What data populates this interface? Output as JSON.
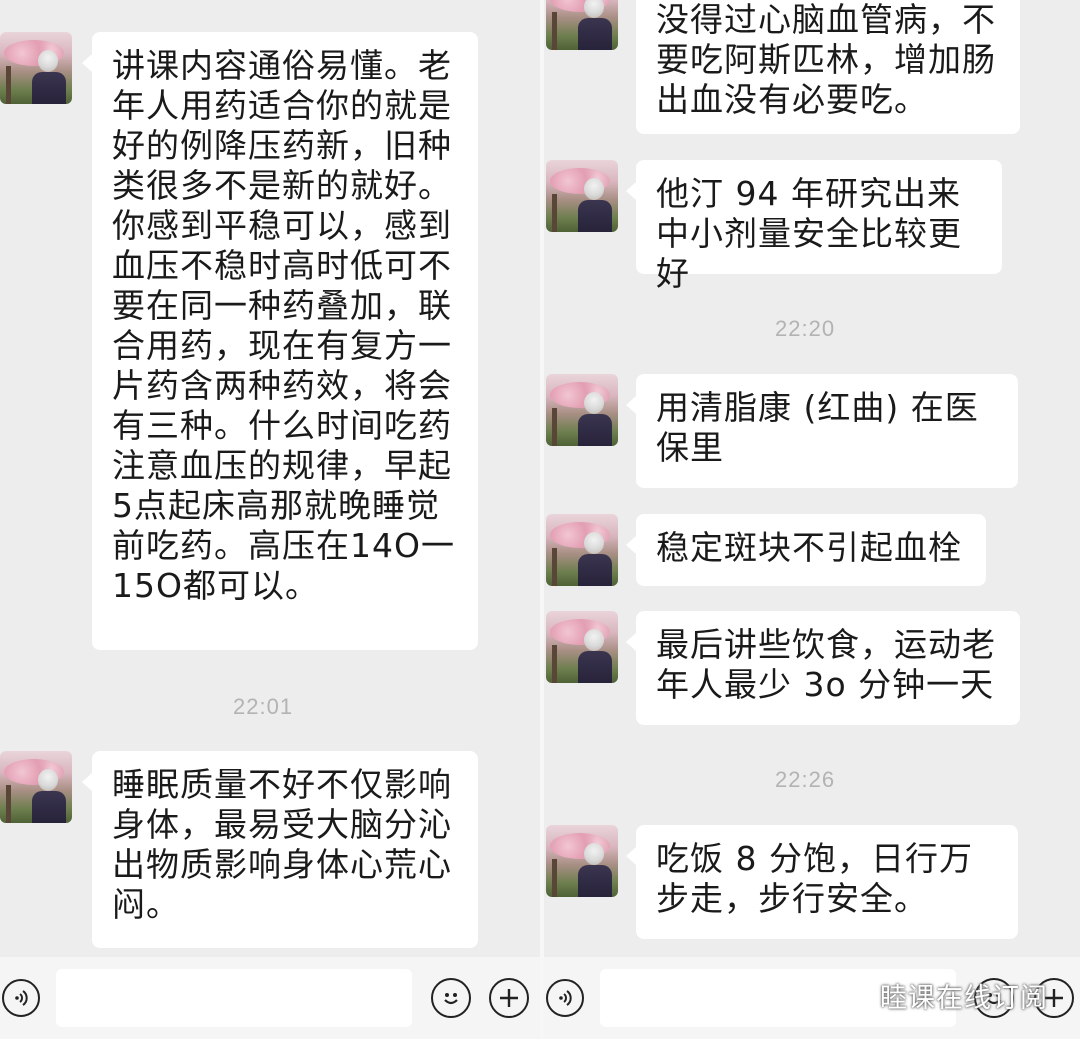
{
  "left": {
    "message1": "讲课内容通俗易懂。老年人用药适合你的就是好的例降压药新，旧种类很多不是新的就好。你感到平稳可以，感到血压不稳时高时低可不要在同一种药叠加，联合用药，现在有复方一片药含两种药效，将会有三种。什么时间吃药注意血压的规律，早起5点起床高那就晚睡觉前吃药。高压在14O一15O都可以。",
    "timestamp1": "22:01",
    "message2": "睡眠质量不好不仅影响身体，最易受大脑分沁出物质影响身体心荒心闷。"
  },
  "right": {
    "message0": "没得过心脑血管病，不要吃阿斯匹林，增加肠出血没有必要吃。",
    "message1": "他汀 94 年研究出来中小剂量安全比较更好",
    "timestamp1": "22:20",
    "message2": "用清脂康 (红曲) 在医保里",
    "message3": "稳定斑块不引起血栓",
    "message4": "最后讲些饮食，运动老年人最少 3o 分钟一天",
    "timestamp2": "22:26",
    "message5": "吃饭 8 分饱，日行万步走，步行安全。"
  },
  "watermark": {
    "text": "睦课在线订阅"
  },
  "icons": {
    "voice": "voice-icon",
    "emoji": "emoji-icon",
    "plus": "plus-icon",
    "wechat": "wechat-logo-icon"
  },
  "colors": {
    "background": "#ededed",
    "bubble": "#ffffff",
    "timestamp": "#b3b3b3",
    "text": "#1a1a1a"
  }
}
